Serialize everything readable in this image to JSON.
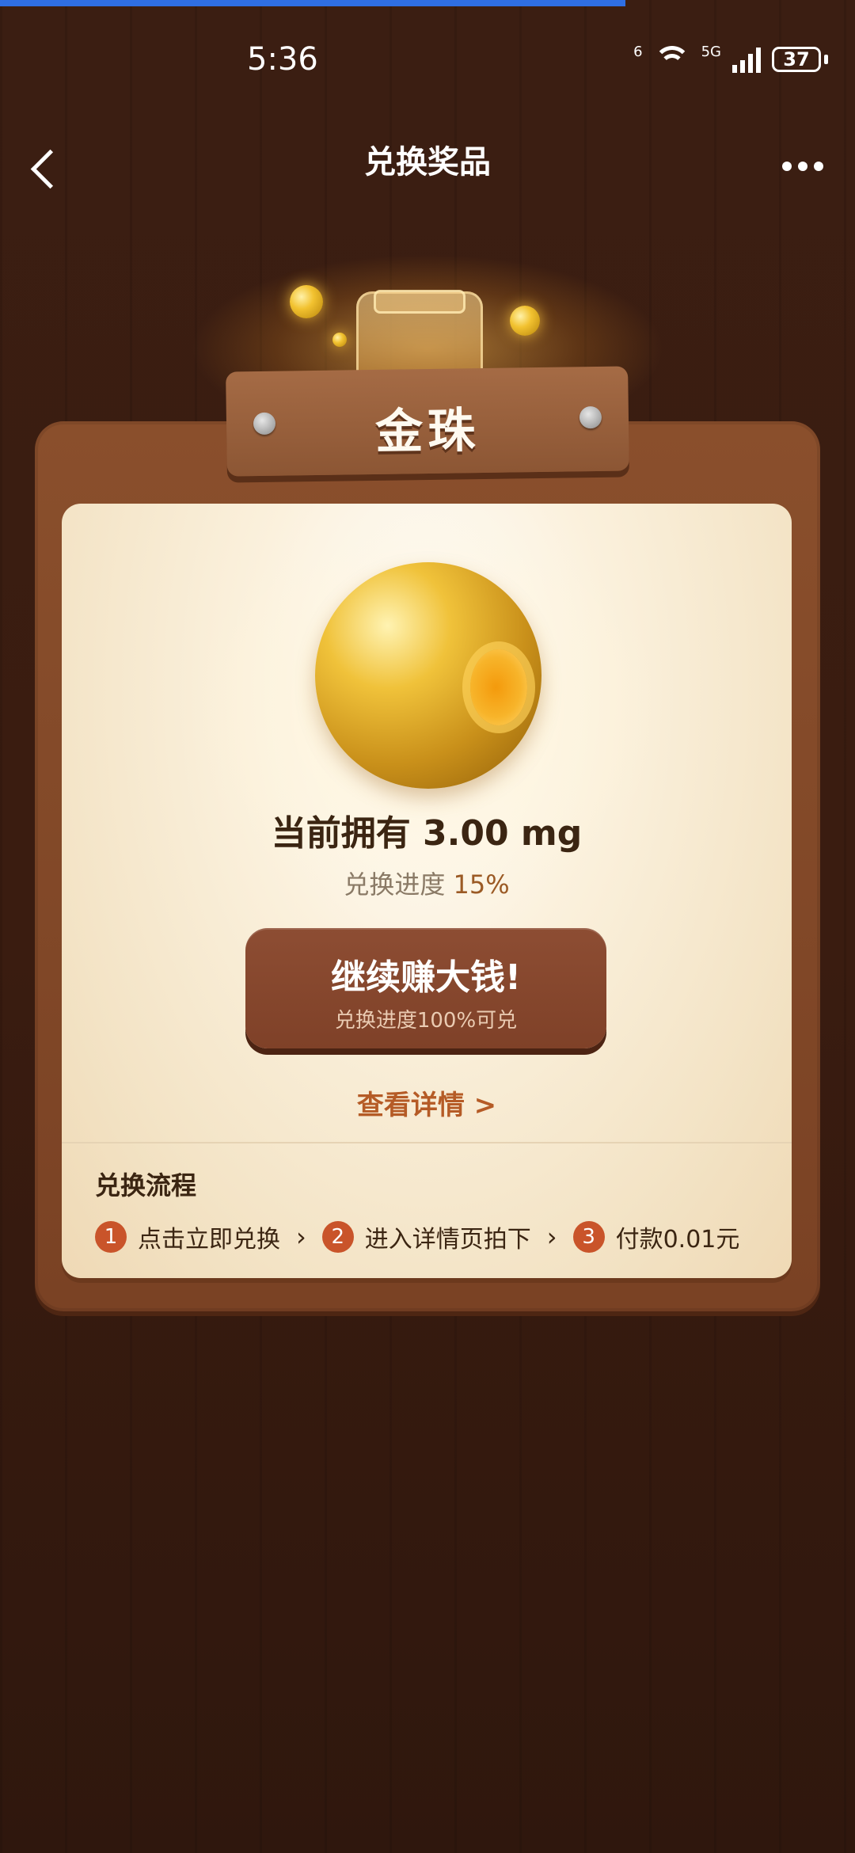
{
  "status_bar": {
    "time": "5:36",
    "battery": "37",
    "net_left": "6",
    "net_right": "5G"
  },
  "header": {
    "title": "兑换奖品"
  },
  "prize": {
    "name": "金珠",
    "owned_label": "当前拥有 3.00 mg",
    "progress_label": "兑换进度",
    "progress_value": "15%",
    "progress_fraction": 0.15
  },
  "cta": {
    "main_label": "继续赚大钱!",
    "sub_label": "兑换进度100%可兑"
  },
  "details_link": "查看详情 >",
  "flow": {
    "title": "兑换流程",
    "steps": [
      {
        "num": "1",
        "text": "点击立即兑换"
      },
      {
        "num": "2",
        "text": "进入详情页拍下"
      },
      {
        "num": "3",
        "text": "付款0.01元"
      }
    ]
  },
  "colors": {
    "background": "#3a1c10",
    "card": "#fbf1dd",
    "button": "#8a4a2f",
    "accent": "#c9542a"
  }
}
